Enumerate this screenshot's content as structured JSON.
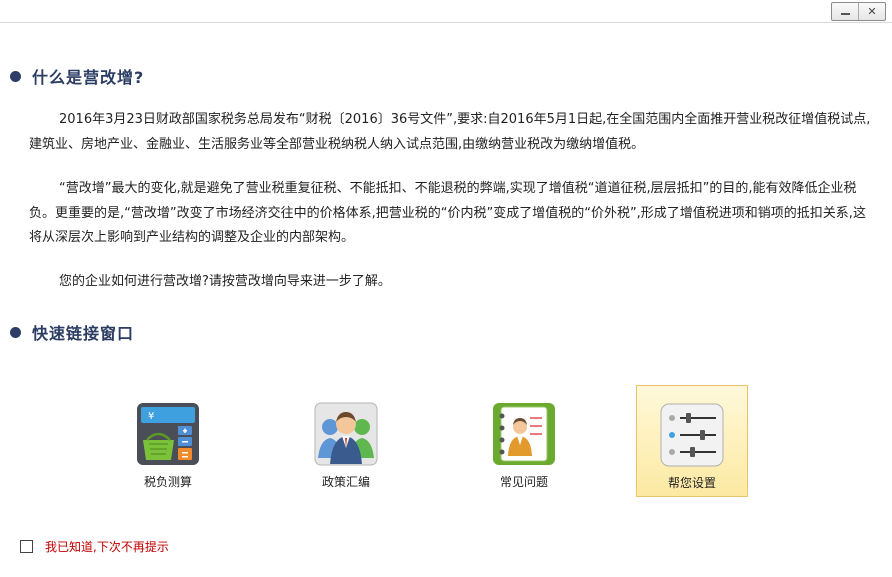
{
  "window": {
    "minimize_glyph": "",
    "close_glyph": "✕"
  },
  "section1": {
    "title": "什么是营改增?"
  },
  "paragraphs": [
    "2016年3月23日财政部国家税务总局发布“财税〔2016〕36号文件”,要求:自2016年5月1日起,在全国范围内全面推开营业税改征增值税试点,建筑业、房地产业、金融业、生活服务业等全部营业税纳税人纳入试点范围,由缴纳营业税改为缴纳增值税。",
    "“营改增”最大的变化,就是避免了营业税重复征税、不能抵扣、不能退税的弊端,实现了增值税“道道征税,层层抵扣”的目的,能有效降低企业税负。更重要的是,“营改增”改变了市场经济交往中的价格体系,把营业税的“价内税”变成了增值税的“价外税”,形成了增值税进项和销项的抵扣关系,这将从深层次上影响到产业结构的调整及企业的内部架构。",
    "您的企业如何进行营改增?请按营改增向导来进一步了解。"
  ],
  "section2": {
    "title": "快速链接窗口"
  },
  "quick_links": [
    {
      "label": "税负测算",
      "icon": "calculator-icon",
      "selected": false
    },
    {
      "label": "政策汇编",
      "icon": "people-icon",
      "selected": false
    },
    {
      "label": "常见问题",
      "icon": "notebook-person-icon",
      "selected": false
    },
    {
      "label": "帮您设置",
      "icon": "settings-sliders-icon",
      "selected": true
    }
  ],
  "dismiss": {
    "label": "我已知道,下次不再提示",
    "checked": false
  },
  "colors": {
    "heading": "#2b3d63",
    "dismiss_text": "#c00000",
    "selected_tile": "#fce9a2"
  }
}
